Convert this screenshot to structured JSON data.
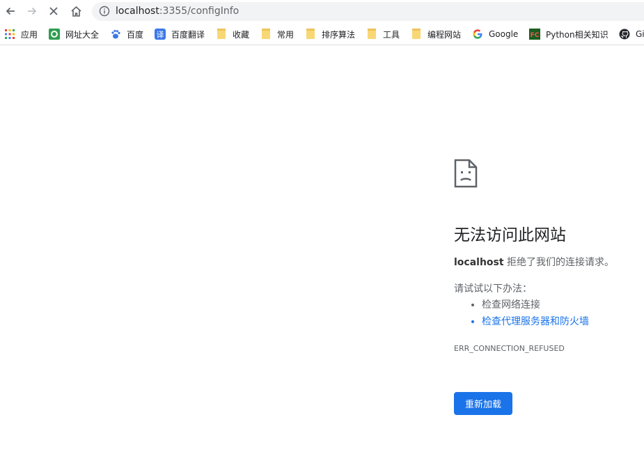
{
  "toolbar": {
    "url_host": "localhost",
    "url_path": ":3355/configInfo"
  },
  "bookmarks": [
    {
      "label": "应用",
      "icon": "apps-grid-icon"
    },
    {
      "label": "网址大全",
      "icon": "site-nav-icon"
    },
    {
      "label": "百度",
      "icon": "baidu-paw-icon"
    },
    {
      "label": "百度翻译",
      "icon": "baidu-translate-icon"
    },
    {
      "label": "收藏",
      "icon": "folder-icon"
    },
    {
      "label": "常用",
      "icon": "folder-icon"
    },
    {
      "label": "排序算法",
      "icon": "folder-icon"
    },
    {
      "label": "工具",
      "icon": "folder-icon"
    },
    {
      "label": "编程网站",
      "icon": "folder-icon"
    },
    {
      "label": "Google",
      "icon": "google-icon"
    },
    {
      "label": "Python相关知识",
      "icon": "fc-icon"
    },
    {
      "label": "Gi",
      "icon": "github-icon"
    }
  ],
  "error": {
    "title": "无法访问此网站",
    "host": "localhost",
    "message": " 拒绝了我们的连接请求。",
    "try_label": "请试试以下办法：",
    "suggestions": [
      "检查网络连接",
      "检查代理服务器和防火墙"
    ],
    "code": "ERR_CONNECTION_REFUSED",
    "reload_label": "重新加载"
  },
  "colors": {
    "accent": "#1a73e8",
    "folder": "#f8d775"
  }
}
